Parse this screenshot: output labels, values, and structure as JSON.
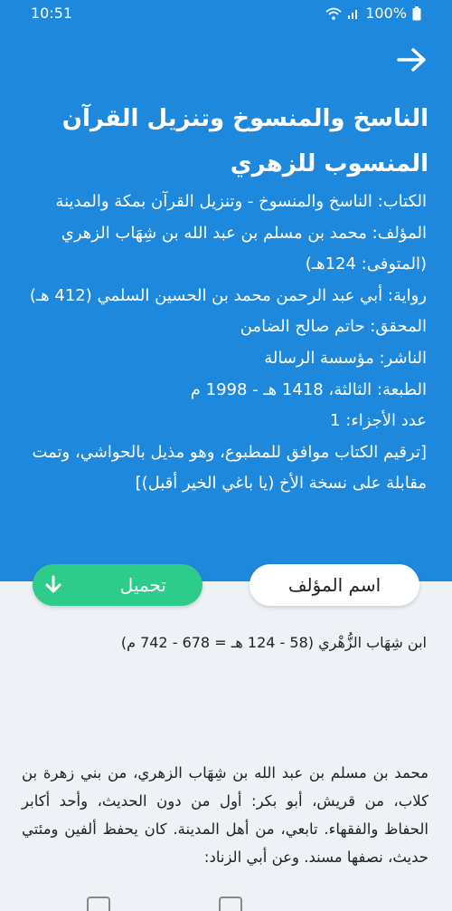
{
  "status_bar": {
    "time": "10:51",
    "battery": "100%"
  },
  "header": {
    "title": "الناسخ والمنسوخ وتنزيل القرآن المنسوب للزهري",
    "info_lines": [
      "الكتاب: الناسخ والمنسوخ - وتنزيل القرآن بمكة والمدينة",
      "المؤلف: محمد بن مسلم بن عبد الله بن شِهَاب الزهري (المتوفى: 124هـ)",
      "رواية: أبي عبد الرحمن محمد بن الحسين السلمي (412 هـ)",
      "المحقق: حاتم صالح الضامن",
      "الناشر: مؤسسة الرسالة",
      "الطبعة: الثالثة، 1418 هـ - 1998 م",
      "عدد الأجزاء: 1",
      "[ترقيم الكتاب موافق للمطبوع، وهو مذيل بالحواشي، وتمت مقابلة على نسخة الأخ (يا باغي الخير أقبل)]"
    ]
  },
  "buttons": {
    "author_name": "اسم المؤلف",
    "download": "تحميل"
  },
  "author": {
    "short": "ابن شِهَاب الزُّهْري (58 - 124 هـ = 678 - 742 م)",
    "bio": "محمد بن مسلم بن عبد الله بن شِهَاب الزهري، من بني زهرة بن كلاب، من قريش، أبو بكر: أول من دون الحديث، وأحد أكابر الحفاظ والفقهاء. تابعي، من أهل المدينة. كان يحفظ ألفين ومئتي حديث، نصفها مسند. وعن أبي الزناد:"
  },
  "colors": {
    "header": "#1e88dc",
    "download": "#2ecc8a",
    "background": "#eef2f7"
  },
  "icons": {
    "back": "arrow-right-icon",
    "download": "download-arrow-icon",
    "wifi": "wifi-icon",
    "signal": "signal-icon",
    "battery": "battery-icon"
  }
}
